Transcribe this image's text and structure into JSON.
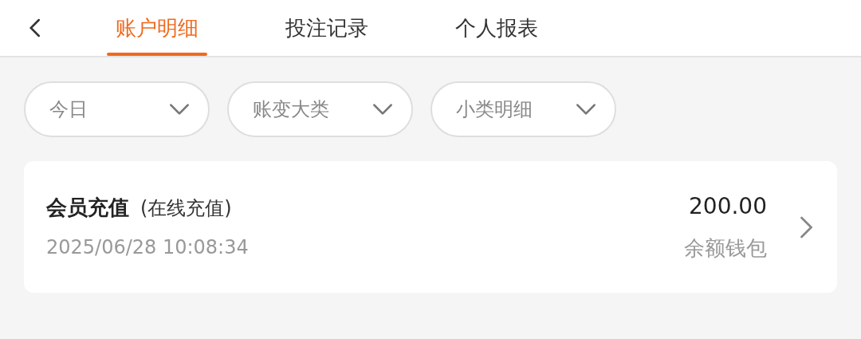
{
  "tabs": [
    {
      "label": "账户明细",
      "selected": true
    },
    {
      "label": "投注记录",
      "selected": false
    },
    {
      "label": "个人报表",
      "selected": false
    }
  ],
  "filters": [
    {
      "label": "今日"
    },
    {
      "label": "账变大类"
    },
    {
      "label": "小类明细"
    }
  ],
  "records": [
    {
      "title": "会员充值",
      "subtitle": "(在线充值)",
      "time": "2025/06/28 10:08:34",
      "amount": "200.00",
      "wallet": "余额钱包"
    }
  ]
}
